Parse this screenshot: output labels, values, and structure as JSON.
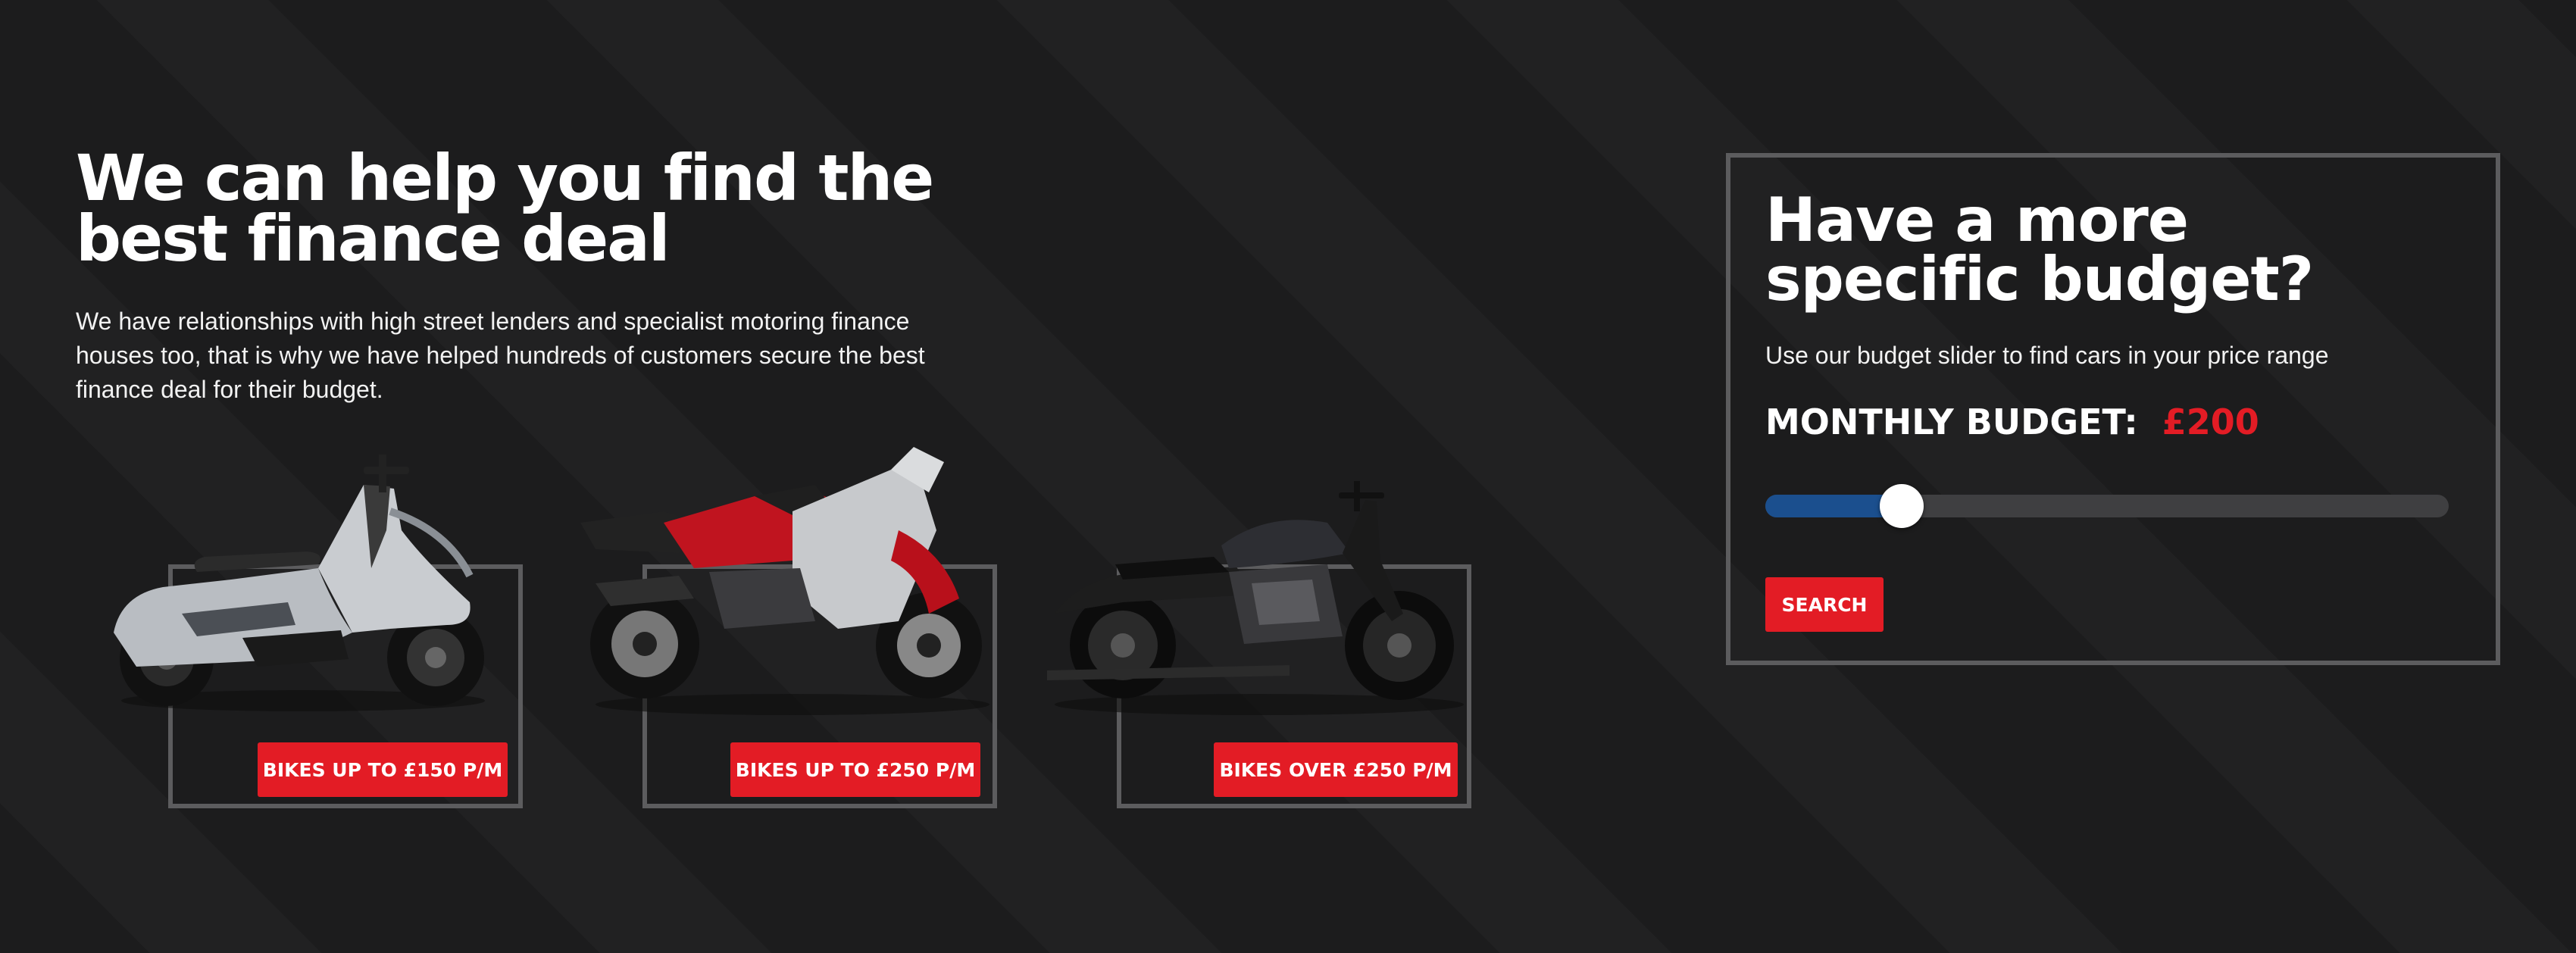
{
  "hero": {
    "title": "We can help you find the best finance deal",
    "description": "We have relationships with high street lenders and specialist motoring finance houses too, that is why we have helped hundreds of customers secure the best finance deal for their budget."
  },
  "bike_cards": [
    {
      "label": "BIKES UP TO £150 P/M",
      "image_icon": "scooter-image"
    },
    {
      "label": "BIKES UP TO £250 P/M",
      "image_icon": "sport-bike-image"
    },
    {
      "label": "BIKES OVER £250 P/M",
      "image_icon": "cruiser-bike-image"
    }
  ],
  "budget": {
    "title": "Have a more specific budget?",
    "subtitle": "Use our budget slider to find cars in your price range",
    "label": "MONTHLY BUDGET:",
    "value": "£200",
    "slider_fraction": 0.2,
    "search_label": "SEARCH"
  },
  "colors": {
    "accent": "#e31c25",
    "background": "#1c1c1d",
    "slider_fill": "#1b4f8e",
    "frame": "#5c5c5e"
  }
}
